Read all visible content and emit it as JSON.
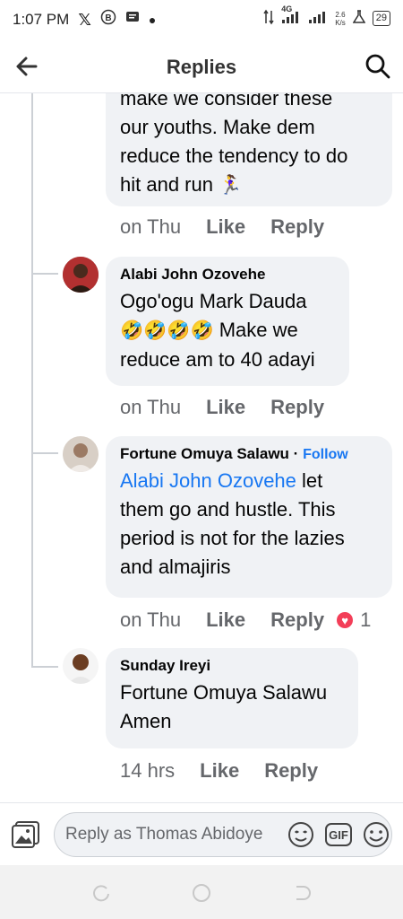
{
  "status_bar": {
    "time": "1:07 PM",
    "network": "4G",
    "speed_value": "2.6",
    "speed_unit": "K/s",
    "battery": "29",
    "icons": [
      "x-icon",
      "b-circle-icon",
      "message-icon",
      "dot",
      "data-arrows-icon",
      "signal-icon",
      "signal-icon",
      "lab-icon",
      "battery-icon"
    ]
  },
  "header": {
    "title": "Replies"
  },
  "comments": [
    {
      "author": "",
      "text_lines": [
        "make we consider these",
        "our youths. Make dem",
        "reduce the tendency to do",
        "hit and run"
      ],
      "emoji": "🏃‍♀️",
      "time": "on Thu",
      "like": "Like",
      "reply": "Reply"
    },
    {
      "author": "Alabi John Ozovehe",
      "mention": "Ogo'ogu Mark Dauda",
      "emoji": "🤣🤣🤣🤣",
      "text_after_emoji": "Make we",
      "text_line2": "reduce am to 40 adayi",
      "time": "on Thu",
      "like": "Like",
      "reply": "Reply"
    },
    {
      "author": "Fortune Omuya Salawu",
      "separator": "·",
      "follow": "Follow",
      "mention": "Alabi John Ozovehe",
      "text_after_mention": "let",
      "text_lines": [
        "them go and hustle. This",
        "period is not for the lazies",
        "and almajiris"
      ],
      "time": "on Thu",
      "like": "Like",
      "reply": "Reply",
      "reaction_count": "1"
    },
    {
      "author": "Sunday Ireyi",
      "mention": "Fortune Omuya Salawu",
      "text": "Amen",
      "time": "14 hrs",
      "like": "Like",
      "reply": "Reply"
    }
  ],
  "compose": {
    "placeholder": "Reply as Thomas Abidoye",
    "gif_label": "GIF"
  },
  "colors": {
    "link": "#1877f2",
    "bubble": "#f0f2f5",
    "meta": "#65676b",
    "heart": "#f33e58"
  }
}
